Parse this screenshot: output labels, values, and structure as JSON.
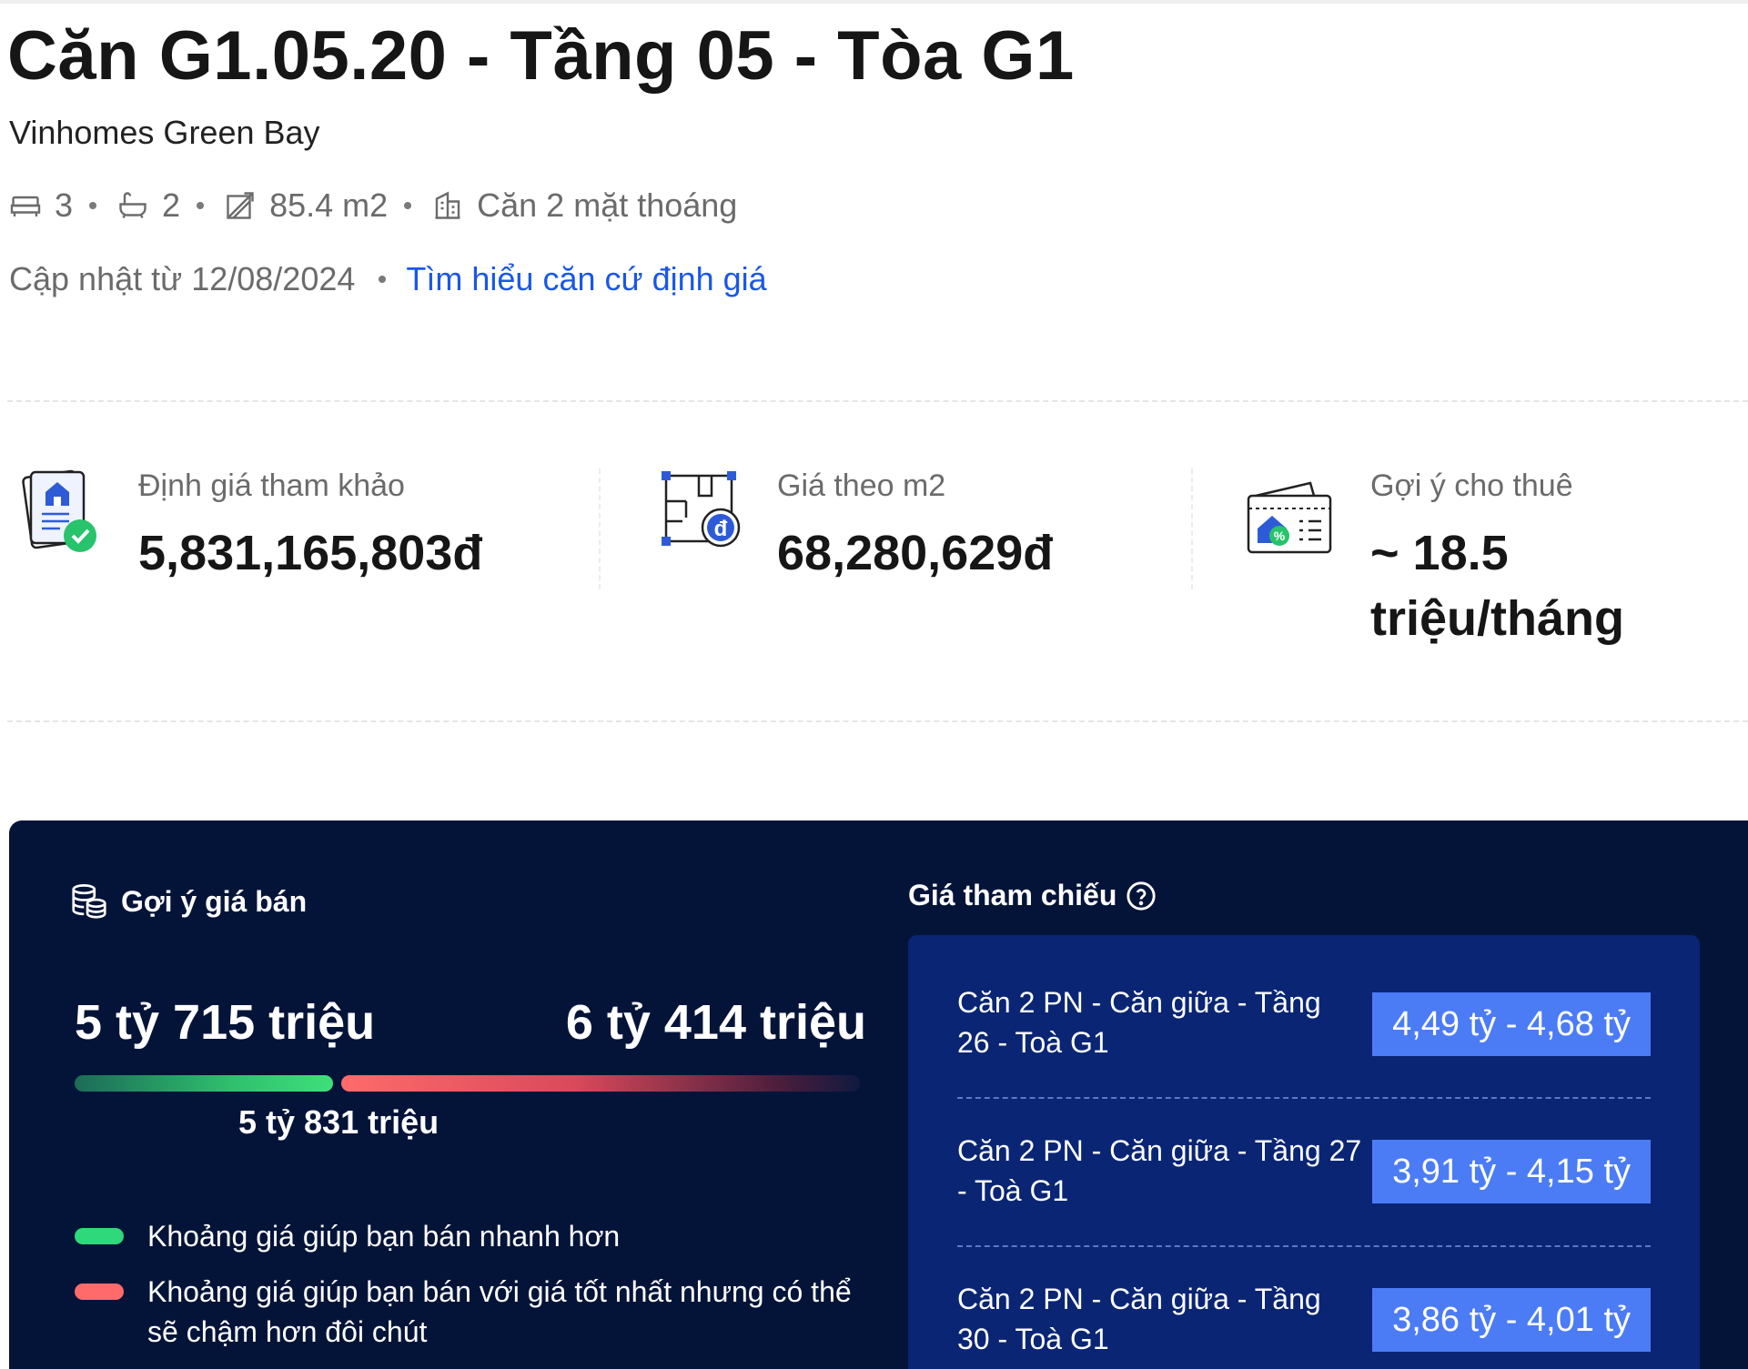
{
  "header": {
    "title": "Căn G1.05.20 - Tầng 05 - Tòa G1",
    "project": "Vinhomes Green Bay"
  },
  "specs": {
    "bedrooms": "3",
    "bathrooms": "2",
    "area": "85.4 m2",
    "view": "Căn 2 mặt thoáng"
  },
  "updated": {
    "text": "Cập nhật từ 12/08/2024",
    "link": "Tìm hiểu căn cứ định giá"
  },
  "stats": [
    {
      "label": "Định giá tham khảo",
      "value": "5,831,165,803đ",
      "icon": "valuation-document-icon"
    },
    {
      "label": "Giá theo m2",
      "value": "68,280,629đ",
      "icon": "floorplan-price-icon"
    },
    {
      "label": "Gợi ý cho thuê",
      "value_line1": "~ 18.5",
      "value_line2": "triệu/tháng",
      "icon": "rent-wallet-icon"
    }
  ],
  "sell": {
    "title": "Gợi ý giá bán",
    "low": "5 tỷ 715 triệu",
    "high": "6 tỷ 414 triệu",
    "mid": "5 tỷ 831 triệu",
    "legend_fast": "Khoảng giá giúp bạn bán nhanh hơn",
    "legend_best_line1": "Khoảng giá giúp bạn bán với giá tốt nhất nhưng có thể",
    "legend_best_line2": "sẽ chậm hơn đôi chút"
  },
  "reference": {
    "title": "Giá tham chiếu",
    "rows": [
      {
        "line1": "Căn 2 PN - Căn giữa - Tầng",
        "line2": "26 - Toà G1",
        "price": "4,49 tỷ - 4,68 tỷ"
      },
      {
        "line1": "Căn 2 PN - Căn giữa - Tầng 27",
        "line2": "- Toà G1",
        "price": "3,91 tỷ - 4,15 tỷ"
      },
      {
        "line1": "Căn 2 PN - Căn giữa - Tầng",
        "line2": "30 - Toà G1",
        "price": "3,86 tỷ - 4,01 tỷ"
      }
    ]
  },
  "colors": {
    "link": "#1a57e6",
    "panel_bg": "#041439",
    "ref_box_bg": "#0a2574",
    "badge_bg": "#4b7cf6",
    "fast_range": "#2fd87a",
    "best_range": "#ff6b6b"
  }
}
